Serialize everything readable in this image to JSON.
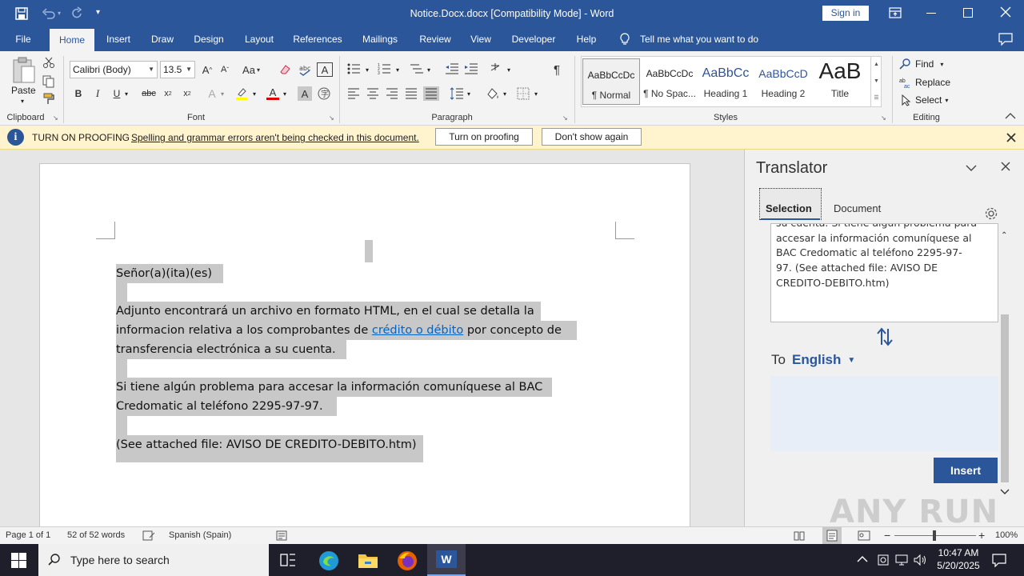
{
  "window": {
    "title": "Notice.Docx.docx [Compatibility Mode]  -  Word",
    "sign_in": "Sign in"
  },
  "tabs": [
    "File",
    "Home",
    "Insert",
    "Draw",
    "Design",
    "Layout",
    "References",
    "Mailings",
    "Review",
    "View",
    "Developer",
    "Help"
  ],
  "tell_me": "Tell me what you want to do",
  "ribbon": {
    "clipboard": {
      "paste": "Paste",
      "label": "Clipboard"
    },
    "font": {
      "name": "Calibri (Body)",
      "size": "13.5",
      "label": "Font",
      "case": "Aa"
    },
    "paragraph": {
      "label": "Paragraph"
    },
    "styles": {
      "label": "Styles",
      "items": [
        {
          "preview": "AaBbCcDc",
          "name": "¶ Normal"
        },
        {
          "preview": "AaBbCcDc",
          "name": "¶ No Spac..."
        },
        {
          "preview": "AaBbCc",
          "name": "Heading 1"
        },
        {
          "preview": "AaBbCcD",
          "name": "Heading 2"
        },
        {
          "preview": "AaB",
          "name": "Title"
        }
      ]
    },
    "editing": {
      "label": "Editing",
      "find": "Find",
      "replace": "Replace",
      "select": "Select"
    }
  },
  "infobar": {
    "title": "TURN ON PROOFING",
    "message": "Spelling and grammar errors aren't being checked in this document.",
    "btn_turn_on": "Turn on proofing",
    "btn_dont_show": "Don't show again"
  },
  "document": {
    "lines": [
      "Señor(a)(ita)(es)",
      "Adjunto  encontrará un archivo en formato HTML, en el cual se detalla la",
      "transferencia electrónica a su cuenta.",
      "Si tiene algún problema para accesar la información comuníquese al BAC",
      "Credomatic al teléfono 2295-97-97.",
      "(See attached file: AVISO DE CREDITO-DEBITO.htm)"
    ],
    "line2_before": "informacion relativa a los comprobantes de ",
    "line2_link": "crédito o débito",
    "line2_after": " por concepto de"
  },
  "translator": {
    "title": "Translator",
    "tab_selection": "Selection",
    "tab_document": "Document",
    "source_lines": [
      "su cuenta.  Si tiene algún problema para",
      "accesar la información comuníquese al",
      "BAC Credomatic al teléfono 2295-97-",
      "97.  (See attached file: AVISO DE",
      "CREDITO-DEBITO.htm)"
    ],
    "to_label": "To",
    "language": "English",
    "insert": "Insert"
  },
  "status": {
    "page": "Page 1 of 1",
    "words": "52 of 52 words",
    "language": "Spanish (Spain)",
    "zoom": "100%"
  },
  "taskbar": {
    "search": "Type here to search",
    "time": "10:47 AM",
    "date": "5/20/2025"
  },
  "watermark": "ANY RUN",
  "colors": {
    "accent": "#2b579a",
    "infobar": "#fff4ce",
    "insert_btn": "#2b579a",
    "highlight": "#c8c8c8",
    "link": "#0563c1"
  }
}
